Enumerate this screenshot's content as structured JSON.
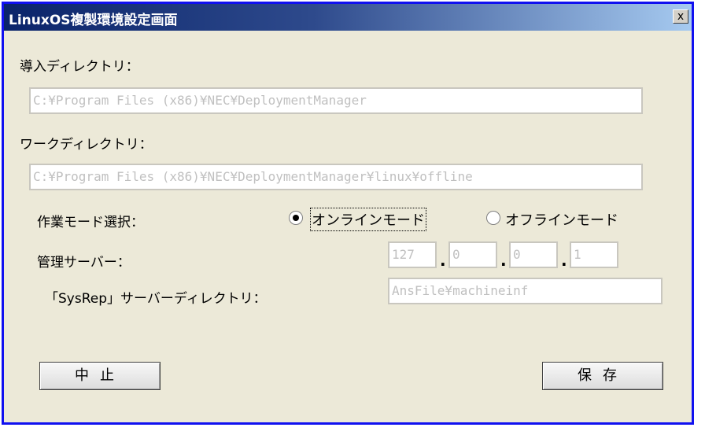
{
  "window": {
    "title": "LinuxOS複製環境設定画面",
    "close_label": "x"
  },
  "install_dir": {
    "label": "導入ディレクトリ：",
    "value": "C:¥Program Files (x86)¥NEC¥DeploymentManager"
  },
  "work_dir": {
    "label": "ワークディレクトリ：",
    "value": "C:¥Program Files (x86)¥NEC¥DeploymentManager¥linux¥offline"
  },
  "mode": {
    "label": "作業モード選択：",
    "options": [
      {
        "label": "オンラインモード",
        "selected": true
      },
      {
        "label": "オフラインモード",
        "selected": false
      }
    ]
  },
  "server": {
    "label": "管理サーバー：",
    "octets": [
      "127",
      "0",
      "0",
      "1"
    ],
    "separator": "."
  },
  "sysrep_dir": {
    "label": "「SysRep」サーバーディレクトリ：",
    "value": "AnsFile¥machineinf"
  },
  "buttons": {
    "cancel": "中止",
    "save": "保存"
  }
}
